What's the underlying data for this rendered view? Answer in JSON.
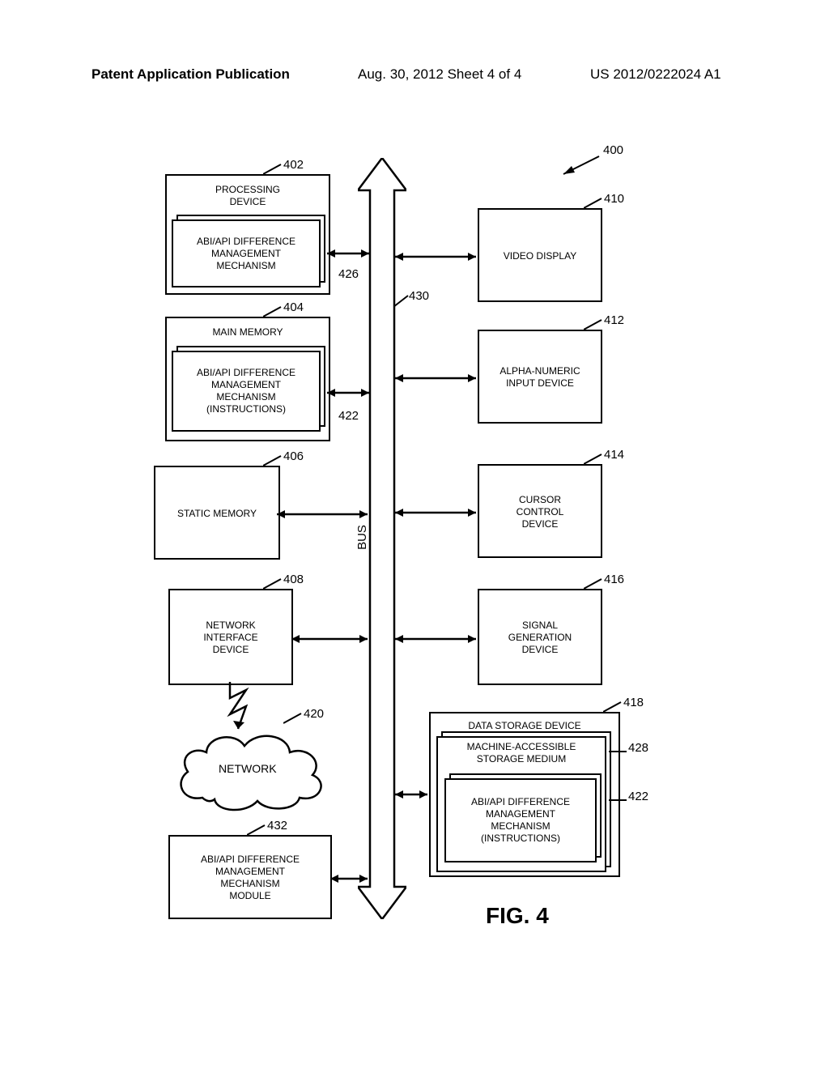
{
  "header": {
    "left": "Patent Application Publication",
    "mid": "Aug. 30, 2012  Sheet 4 of 4",
    "right": "US 2012/0222024 A1"
  },
  "refs": {
    "r400": "400",
    "r402": "402",
    "r404": "404",
    "r406": "406",
    "r408": "408",
    "r410": "410",
    "r412": "412",
    "r414": "414",
    "r416": "416",
    "r418": "418",
    "r420": "420",
    "r422a": "422",
    "r422b": "422",
    "r426": "426",
    "r428": "428",
    "r430": "430",
    "r432": "432"
  },
  "boxes": {
    "processing": {
      "title": "PROCESSING\nDEVICE",
      "inner": "ABI/API DIFFERENCE\nMANAGEMENT\nMECHANISM"
    },
    "mainmem": {
      "title": "MAIN MEMORY",
      "inner": "ABI/API DIFFERENCE\nMANAGEMENT\nMECHANISM\n(INSTRUCTIONS)"
    },
    "staticmem": {
      "title": "STATIC MEMORY"
    },
    "netif": {
      "title": "NETWORK\nINTERFACE\nDEVICE"
    },
    "video": {
      "title": "VIDEO DISPLAY"
    },
    "alpha": {
      "title": "ALPHA-NUMERIC\nINPUT DEVICE"
    },
    "cursor": {
      "title": "CURSOR\nCONTROL\nDEVICE"
    },
    "signal": {
      "title": "SIGNAL\nGENERATION\nDEVICE"
    },
    "storage": {
      "title": "DATA STORAGE DEVICE",
      "inner1": "MACHINE-ACCESSIBLE\nSTORAGE MEDIUM",
      "inner2": "ABI/API DIFFERENCE\nMANAGEMENT\nMECHANISM\n(INSTRUCTIONS)"
    },
    "module": {
      "title": "ABI/API DIFFERENCE\nMANAGEMENT\nMECHANISM\nMODULE"
    },
    "network": "NETWORK"
  },
  "bus_label": "BUS",
  "figure_label": "FIG. 4"
}
